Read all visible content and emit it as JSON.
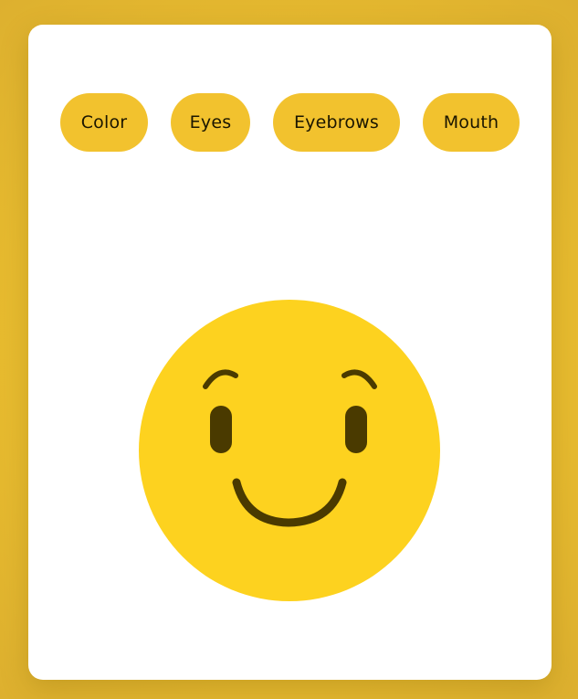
{
  "toolbar": {
    "buttons": [
      {
        "label": "Color"
      },
      {
        "label": "Eyes"
      },
      {
        "label": "Eyebrows"
      },
      {
        "label": "Mouth"
      }
    ]
  },
  "emoji": {
    "face_color": "#fdd21f",
    "feature_color": "#4a3a00"
  },
  "theme": {
    "page_bg": "#ecc12f",
    "card_bg": "#ffffff",
    "button_bg": "#f2c22e",
    "button_text": "#1b1600"
  }
}
